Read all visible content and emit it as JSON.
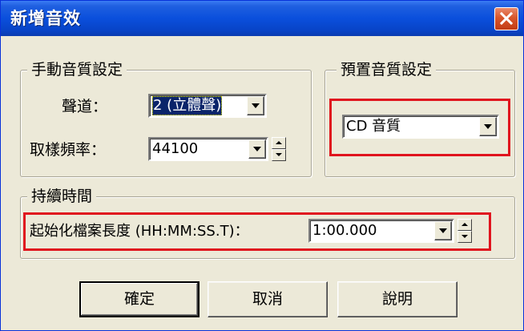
{
  "dialog": {
    "title": "新增音效"
  },
  "manual_quality": {
    "legend": "手動音質設定",
    "channel_label": "聲道：",
    "channel_value": "2 (立體聲)",
    "sample_rate_label": "取樣頻率：",
    "sample_rate_value": "44100"
  },
  "preset_quality": {
    "legend": "預置音質設定",
    "preset_value": "CD 音質"
  },
  "duration": {
    "legend": "持續時間",
    "length_label": "起始化檔案長度 (HH:MM:SS.T)：",
    "length_value": "1:00.000"
  },
  "buttons": {
    "ok": "確定",
    "cancel": "取消",
    "help": "說明"
  },
  "colors": {
    "titlebar": "#0a4fdc",
    "dialog_face": "#ece9d8",
    "highlight": "#e0141e",
    "selection": "#0a246a"
  },
  "icons": {
    "close": "close-icon",
    "dropdown": "chevron-down-icon",
    "spin_up": "spin-up-icon",
    "spin_down": "spin-down-icon"
  }
}
